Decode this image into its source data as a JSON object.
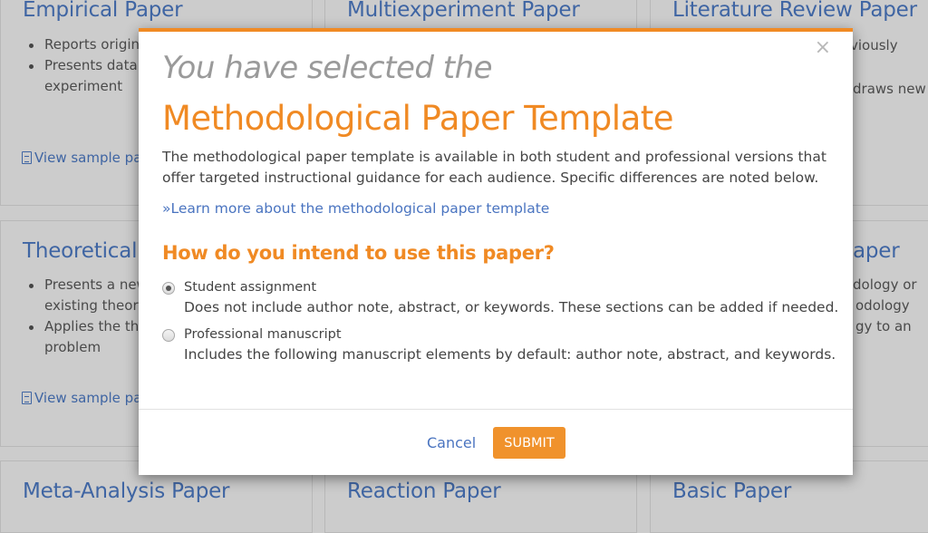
{
  "background": {
    "cards": [
      {
        "title": "Empirical Paper",
        "bullets": [
          "Reports original",
          "Presents data",
          "experiment"
        ],
        "sample_link": "View sample pa"
      },
      {
        "title": "Multiexperiment Paper"
      },
      {
        "title": "Literature Review Paper",
        "lines": [
          "viously",
          "draws new"
        ]
      },
      {
        "title": "Theoretical",
        "bullets": [
          "Presents a new",
          "existing theory",
          "Applies the th",
          "problem"
        ],
        "sample_link": "View sample pa"
      },
      {
        "title": "aper",
        "lines": [
          "dology or",
          "odology",
          "gy to an"
        ]
      },
      {
        "title": "Meta-Analysis Paper"
      },
      {
        "title": "Reaction Paper"
      },
      {
        "title": "Basic Paper"
      }
    ]
  },
  "modal": {
    "close_icon": "×",
    "eyebrow": "You have selected the",
    "title": "Methodological Paper Template",
    "description": "The methodological paper template is available in both student and professional versions that offer targeted instructional guidance for each audience. Specific differences are noted below.",
    "learn_more": "»Learn more about the methodological paper template",
    "question": "How do you intend to use this paper?",
    "options": [
      {
        "label": "Student assignment",
        "description": "Does not include author note, abstract, or keywords. These sections can be added if needed.",
        "selected": true
      },
      {
        "label": "Professional manuscript",
        "description": "Includes the following manuscript elements by default: author note, abstract, and keywords.",
        "selected": false
      }
    ],
    "cancel_label": "Cancel",
    "submit_label": "SUBMIT"
  },
  "colors": {
    "accent": "#f08a24",
    "link": "#4a74c0",
    "overlay": "#cccccc"
  }
}
